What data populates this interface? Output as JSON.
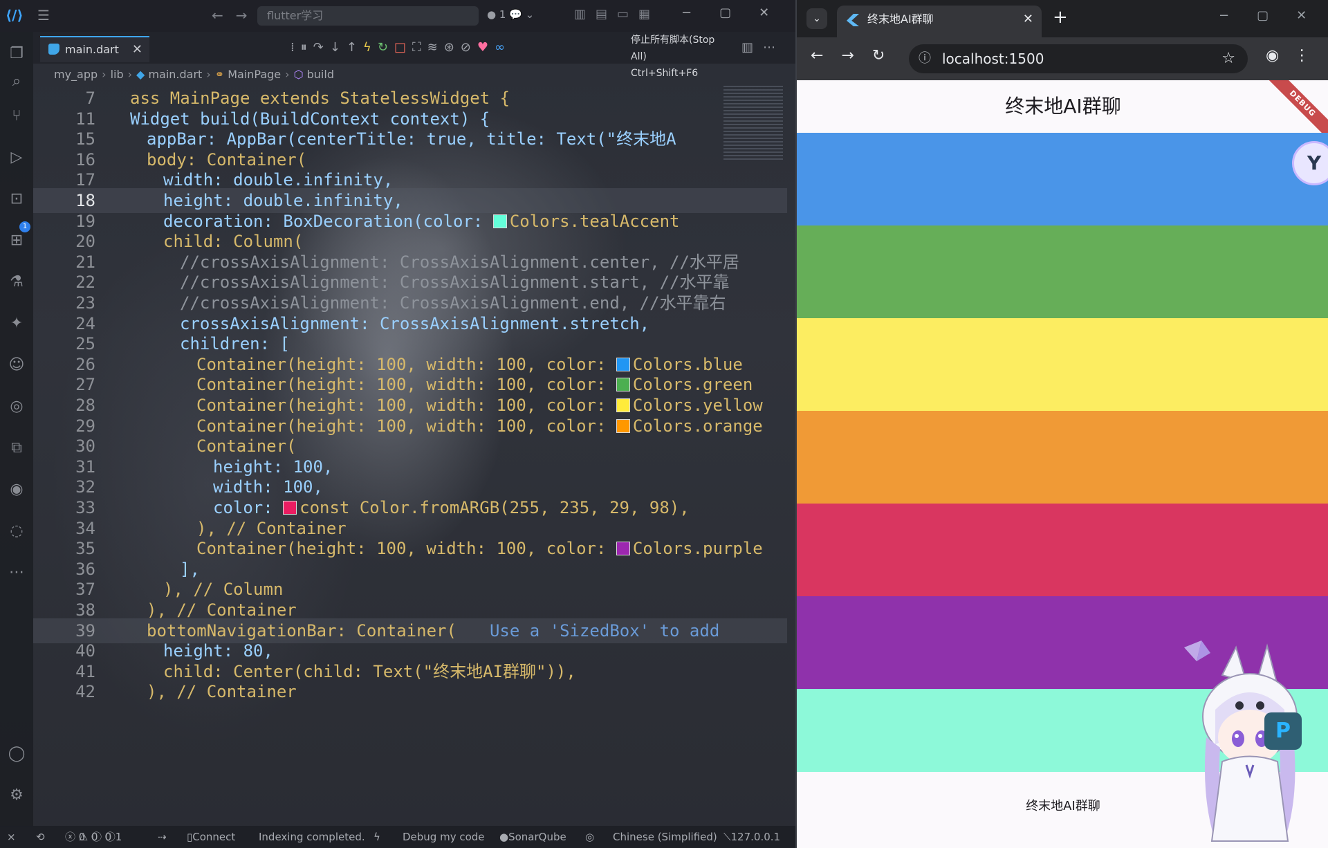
{
  "vscode": {
    "title_search": "flutter学习",
    "title_badge": "● 1",
    "tab": {
      "label": "main.dart"
    },
    "stop_tooltip": {
      "line1": "停止所有脚本(Stop All)",
      "line2": "Ctrl+Shift+F6"
    },
    "breadcrumb": [
      "my_app",
      "lib",
      "main.dart",
      "MainPage",
      "build"
    ],
    "code_lines": [
      {
        "num": "7",
        "text": "ass MainPage extends StatelessWidget {"
      },
      {
        "num": "11",
        "text": "Widget build(BuildContext context) {"
      },
      {
        "num": "15",
        "text": "appBar: AppBar(centerTitle: true, title: Text(\"终末地A"
      },
      {
        "num": "16",
        "text": "body: Container("
      },
      {
        "num": "17",
        "text": "width: double.infinity,"
      },
      {
        "num": "18",
        "text": "height: double.infinity,"
      },
      {
        "num": "19",
        "text": "decoration: BoxDecoration(color: ",
        "tail": "Colors.tealAccent"
      },
      {
        "num": "20",
        "text": "child: Column("
      },
      {
        "num": "21",
        "text": "//crossAxisAlignment: CrossAxisAlignment.center, //水平居"
      },
      {
        "num": "22",
        "text": "//crossAxisAlignment: CrossAxisAlignment.start, //水平靠"
      },
      {
        "num": "23",
        "text": "//crossAxisAlignment: CrossAxisAlignment.end, //水平靠右"
      },
      {
        "num": "24",
        "text": "crossAxisAlignment: CrossAxisAlignment.stretch,"
      },
      {
        "num": "25",
        "text": "children: ["
      },
      {
        "num": "26",
        "text": "Container(height: 100, width: 100, color: ",
        "tail": "Colors.blue"
      },
      {
        "num": "27",
        "text": "Container(height: 100, width: 100, color: ",
        "tail": "Colors.green"
      },
      {
        "num": "28",
        "text": "Container(height: 100, width: 100, color: ",
        "tail": "Colors.yellow"
      },
      {
        "num": "29",
        "text": "Container(height: 100, width: 100, color: ",
        "tail": "Colors.orange"
      },
      {
        "num": "30",
        "text": "Container("
      },
      {
        "num": "31",
        "text": "height: 100,"
      },
      {
        "num": "32",
        "text": "width: 100,"
      },
      {
        "num": "33",
        "text": "color: ",
        "tail": "const Color.fromARGB(255, 235, 29, 98),"
      },
      {
        "num": "34",
        "text": "), // Container"
      },
      {
        "num": "35",
        "text": "Container(height: 100, width: 100, color: ",
        "tail": "Colors.purple"
      },
      {
        "num": "36",
        "text": "],"
      },
      {
        "num": "37",
        "text": "), // Column"
      },
      {
        "num": "38",
        "text": "), // Container"
      },
      {
        "num": "39",
        "text": "bottomNavigationBar: Container(",
        "hint": "Use a 'SizedBox' to add"
      },
      {
        "num": "40",
        "text": "height: 80,"
      },
      {
        "num": "41",
        "text": "child: Center(child: Text(\"终末地AI群聊\")),"
      },
      {
        "num": "42",
        "text": "), // Container"
      }
    ],
    "swatches": {
      "19": "#64ffda",
      "26": "#2196f3",
      "27": "#4caf50",
      "28": "#ffeb3b",
      "29": "#ff9800",
      "33": "#eb1d62",
      "35": "#9c27b0"
    },
    "status": {
      "connect": "Connect",
      "indexing": "Indexing completed.",
      "debug": "Debug my code",
      "sonar": "SonarQube",
      "lang": "Chinese (Simplified)",
      "ip": "127.0.0.1",
      "errors": "0",
      "warnings": "0",
      "info": "0",
      "other": "1"
    }
  },
  "browser": {
    "tab_title": "终末地AI群聊",
    "url": "localhost:1500",
    "page": {
      "appbar_title": "终末地AI群聊",
      "debug_banner": "DEBUG",
      "bottom_text": "终末地AI群聊",
      "bars": [
        {
          "name": "blue",
          "color": "#4a95e8"
        },
        {
          "name": "green",
          "color": "#66ae58"
        },
        {
          "name": "yellow",
          "color": "#fced61"
        },
        {
          "name": "orange",
          "color": "#f09a36"
        },
        {
          "name": "pink",
          "color": "#d93660"
        },
        {
          "name": "purple",
          "color": "#8f32ab"
        }
      ],
      "background_color": "#8df9d9"
    }
  }
}
